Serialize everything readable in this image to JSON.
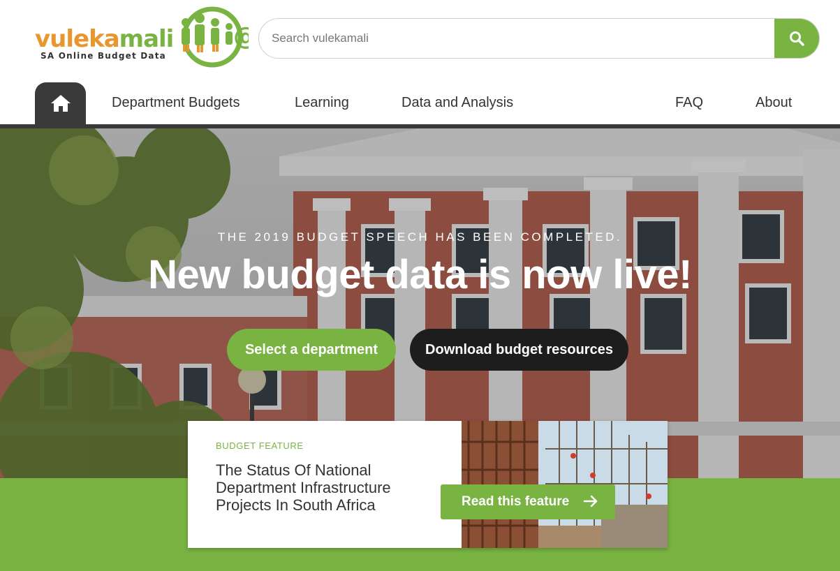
{
  "logo": {
    "word_part1": "vuleka",
    "word_part2": "mali",
    "tagline": "SA Online Budget Data"
  },
  "search": {
    "placeholder": "Search vulekamali",
    "value": "",
    "icon": "search-icon"
  },
  "nav": {
    "home_icon": "home-icon",
    "items": [
      {
        "label": "Department Budgets"
      },
      {
        "label": "Learning"
      },
      {
        "label": "Data and Analysis"
      },
      {
        "label": "FAQ"
      },
      {
        "label": "About"
      }
    ]
  },
  "hero": {
    "kicker": "THE 2019 BUDGET SPEECH HAS BEEN COMPLETED.",
    "title": "New budget data is now live!",
    "primary_button": "Select a department",
    "secondary_button": "Download budget resources"
  },
  "feature": {
    "kicker": "BUDGET FEATURE",
    "title": "The Status Of National Department Infrastructure Projects In South Africa",
    "button": "Read this feature",
    "button_icon": "arrow-right-icon"
  },
  "colors": {
    "brand_green": "#79b342",
    "brand_orange": "#e8962e",
    "dark": "#3a3a3a"
  }
}
